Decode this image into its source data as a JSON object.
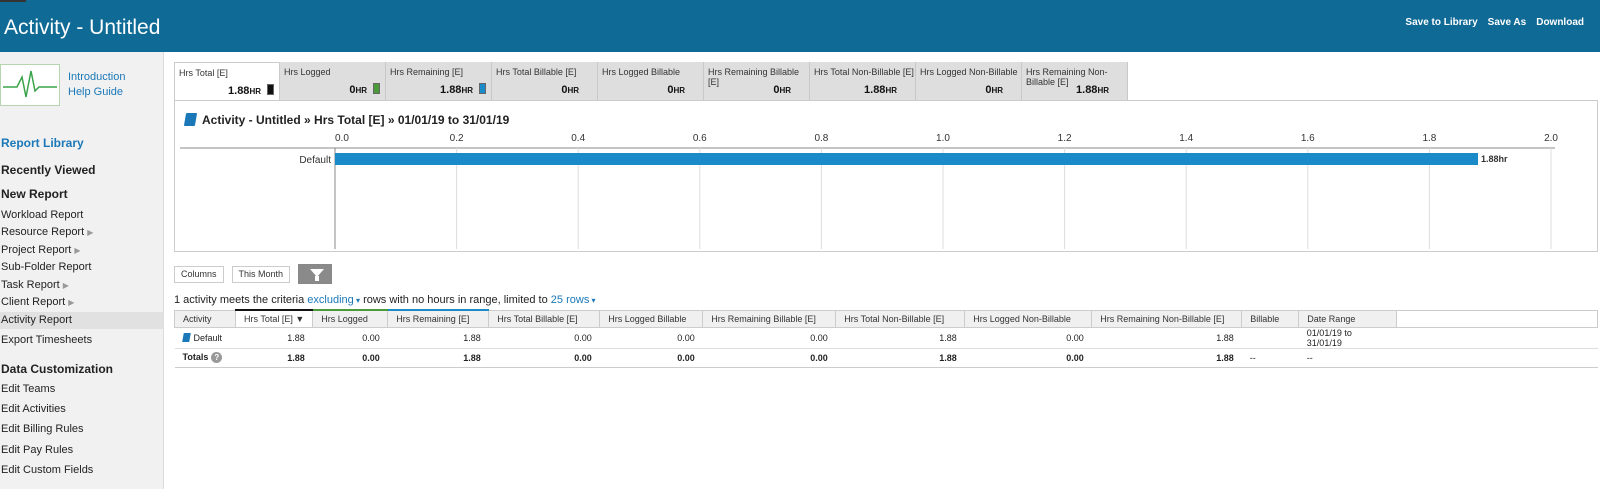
{
  "header": {
    "title": "Activity - Untitled",
    "actions": [
      "Save to Library",
      "Save As",
      "Download"
    ]
  },
  "sidebar": {
    "help_links": [
      "Introduction",
      "Help Guide"
    ],
    "report_library": "Report Library",
    "recently_viewed": "Recently Viewed",
    "new_report": "New Report",
    "new_report_items": [
      {
        "label": "Workload Report",
        "arrow": ""
      },
      {
        "label": "Resource Report",
        "arrow": "▶"
      },
      {
        "label": "Project Report",
        "arrow": "▶"
      },
      {
        "label": "Sub-Folder Report",
        "arrow": ""
      },
      {
        "label": "Task Report",
        "arrow": "▶"
      },
      {
        "label": "Client Report",
        "arrow": "▶"
      },
      {
        "label": "Activity Report",
        "arrow": ""
      },
      {
        "label": "Export Timesheets",
        "arrow": ""
      }
    ],
    "data_customization": "Data Customization",
    "customization_items": [
      "Edit Teams",
      "Edit Activities",
      "Edit Billing Rules",
      "Edit Pay Rules",
      "Edit Custom Fields"
    ]
  },
  "tiles": [
    {
      "label": "Hrs Total [E]",
      "value": "1.88",
      "unit": "HR",
      "swatch": "#111111"
    },
    {
      "label": "Hrs Logged",
      "value": "0",
      "unit": "HR",
      "swatch": "#4a9a3a"
    },
    {
      "label": "Hrs Remaining [E]",
      "value": "1.88",
      "unit": "HR",
      "swatch": "#1a8bc8"
    },
    {
      "label": "Hrs Total Billable [E]",
      "value": "0",
      "unit": "HR",
      "swatch": ""
    },
    {
      "label": "Hrs Logged Billable",
      "value": "0",
      "unit": "HR",
      "swatch": ""
    },
    {
      "label": "Hrs Remaining Billable [E]",
      "value": "0",
      "unit": "HR",
      "swatch": ""
    },
    {
      "label": "Hrs Total Non-Billable [E]",
      "value": "1.88",
      "unit": "HR",
      "swatch": ""
    },
    {
      "label": "Hrs Logged Non-Billable",
      "value": "0",
      "unit": "HR",
      "swatch": ""
    },
    {
      "label": "Hrs Remaining Non-Billable [E]",
      "value": "1.88",
      "unit": "HR",
      "swatch": ""
    }
  ],
  "chart_title": {
    "report": "Activity - Untitled",
    "sep1": "»",
    "metric": "Hrs Total [E]",
    "sep2": "»",
    "range": "01/01/19 to 31/01/19"
  },
  "chart_data": {
    "type": "bar",
    "orientation": "horizontal",
    "categories": [
      "Default"
    ],
    "values": [
      1.88
    ],
    "data_labels": [
      "1.88hr"
    ],
    "xlim": [
      0,
      2.0
    ],
    "ticks": [
      "0.0",
      "0.2",
      "0.4",
      "0.6",
      "0.8",
      "1.0",
      "1.2",
      "1.4",
      "1.6",
      "1.8",
      "2.0"
    ],
    "grid": true,
    "bar_color": "#1a8bc8"
  },
  "controls": {
    "columns": "Columns",
    "this_month": "This Month"
  },
  "criteria": {
    "prefix": "1 activity meets the criteria",
    "excluding": "excluding",
    "middle": "rows with no hours in range, limited to",
    "limit": "25 rows"
  },
  "table": {
    "headers": [
      "Activity",
      "Hrs Total [E]",
      "Hrs Logged",
      "Hrs Remaining [E]",
      "Hrs Total Billable [E]",
      "Hrs Logged Billable",
      "Hrs Remaining Billable [E]",
      "Hrs Total Non-Billable [E]",
      "Hrs Logged Non-Billable",
      "Hrs Remaining Non-Billable [E]",
      "Billable",
      "Date Range"
    ],
    "rows": [
      [
        "Default",
        "1.88",
        "0.00",
        "1.88",
        "0.00",
        "0.00",
        "0.00",
        "1.88",
        "0.00",
        "1.88",
        "",
        "01/01/19 to 31/01/19"
      ]
    ],
    "totals": [
      "Totals",
      "1.88",
      "0.00",
      "1.88",
      "0.00",
      "0.00",
      "0.00",
      "1.88",
      "0.00",
      "1.88",
      "--",
      "--"
    ]
  }
}
